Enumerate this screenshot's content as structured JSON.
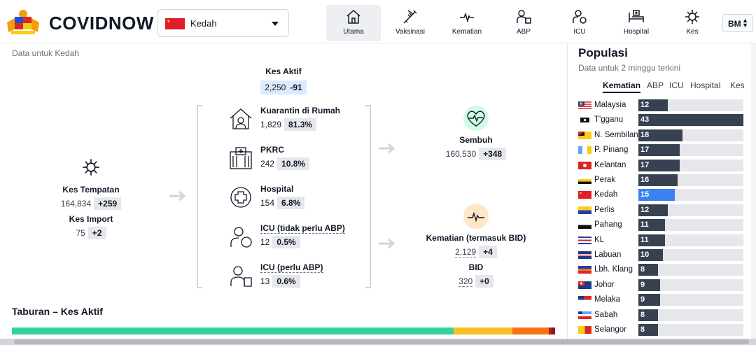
{
  "header": {
    "brand": "COVIDNOW",
    "state_select": {
      "value": "Kedah"
    },
    "nav": [
      {
        "label": "Utama",
        "icon": "home-icon",
        "active": true
      },
      {
        "label": "Vaksinasi",
        "icon": "syringe-icon"
      },
      {
        "label": "Kematian",
        "icon": "heartbeat-icon"
      },
      {
        "label": "ABP",
        "icon": "ventilator-person-icon"
      },
      {
        "label": "ICU",
        "icon": "icu-person-icon"
      },
      {
        "label": "Hospital",
        "icon": "hospital-bed-icon"
      },
      {
        "label": "Kes",
        "icon": "virus-icon"
      }
    ],
    "lang": "BM"
  },
  "main": {
    "subnote": "Data untuk Kedah",
    "active": {
      "title": "Kes Aktif",
      "value": "2,250",
      "delta": "-91"
    },
    "local": {
      "title": "Kes Tempatan",
      "value": "164,834",
      "delta": "+259"
    },
    "import": {
      "title": "Kes Import",
      "value": "75",
      "delta": "+2"
    },
    "components": [
      {
        "title": "Kuarantin di Rumah",
        "value": "1,829",
        "pct": "81.3%",
        "icon": "home-quarantine-icon"
      },
      {
        "title": "PKRC",
        "value": "242",
        "pct": "10.8%",
        "icon": "quarantine-centre-icon"
      },
      {
        "title": "Hospital",
        "value": "154",
        "pct": "6.8%",
        "icon": "hospital-cross-icon"
      },
      {
        "title": "ICU (tidak perlu ABP)",
        "value": "12",
        "pct": "0.5%",
        "icon": "icu-icon"
      },
      {
        "title": "ICU (perlu ABP)",
        "value": "13",
        "pct": "0.6%",
        "icon": "ventilator-icon"
      }
    ],
    "recovered": {
      "title": "Sembuh",
      "value": "160,530",
      "delta": "+348"
    },
    "deaths": {
      "title": "Kematian (termasuk BID)",
      "value": "2,129",
      "delta": "+4"
    },
    "bid": {
      "title": "BID",
      "value": "320",
      "delta": "+0"
    },
    "distribution": {
      "title": "Taburan – Kes Aktif",
      "segments": [
        {
          "pct": 81.3,
          "color": "#34d399"
        },
        {
          "pct": 10.8,
          "color": "#fbbf24"
        },
        {
          "pct": 6.8,
          "color": "#f97316"
        },
        {
          "pct": 0.5,
          "color": "#b91c1c"
        },
        {
          "pct": 0.6,
          "color": "#7f1d1d"
        }
      ]
    }
  },
  "ranking": {
    "title": "Populasi",
    "subtitle": "Data untuk 2 minggu terkini",
    "tabs": [
      "Kematian",
      "ABP",
      "ICU",
      "Hospital",
      "Kes"
    ],
    "active_tab": "Kematian",
    "max": 43,
    "rows": [
      {
        "name": "Malaysia",
        "value": 12,
        "flag": "malaysia"
      },
      {
        "name": "T'gganu",
        "value": 43,
        "flag": "terengganu"
      },
      {
        "name": "N. Sembilan",
        "value": 18,
        "flag": "nsembilan"
      },
      {
        "name": "P. Pinang",
        "value": 17,
        "flag": "penang"
      },
      {
        "name": "Kelantan",
        "value": 17,
        "flag": "kelantan"
      },
      {
        "name": "Perak",
        "value": 16,
        "flag": "perak"
      },
      {
        "name": "Kedah",
        "value": 15,
        "flag": "kedah",
        "highlight": true
      },
      {
        "name": "Perlis",
        "value": 12,
        "flag": "perlis"
      },
      {
        "name": "Pahang",
        "value": 11,
        "flag": "pahang"
      },
      {
        "name": "KL",
        "value": 11,
        "flag": "kl"
      },
      {
        "name": "Labuan",
        "value": 10,
        "flag": "labuan"
      },
      {
        "name": "Lbh. Klang",
        "value": 8,
        "flag": "lbhklang"
      },
      {
        "name": "Johor",
        "value": 9,
        "flag": "johor"
      },
      {
        "name": "Melaka",
        "value": 9,
        "flag": "melaka"
      },
      {
        "name": "Sabah",
        "value": 8,
        "flag": "sabah"
      },
      {
        "name": "Selangor",
        "value": 8,
        "flag": "selangor"
      }
    ]
  }
}
